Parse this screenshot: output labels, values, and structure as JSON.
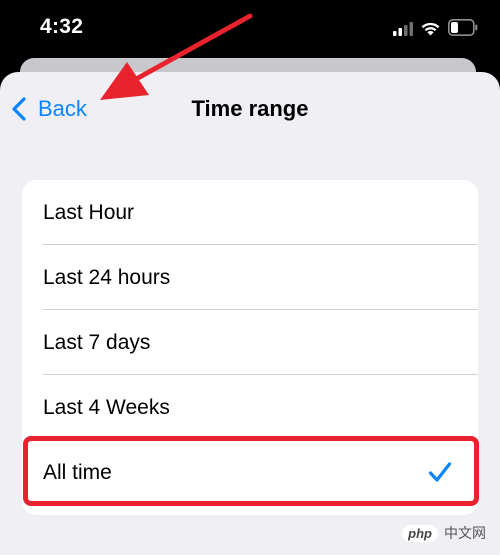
{
  "status_bar": {
    "time": "4:32",
    "icons": [
      "signal-icon",
      "wifi-icon",
      "battery-icon"
    ]
  },
  "nav": {
    "back_label": "Back",
    "title": "Time range"
  },
  "options": [
    {
      "label": "Last Hour",
      "selected": false
    },
    {
      "label": "Last 24 hours",
      "selected": false
    },
    {
      "label": "Last 7 days",
      "selected": false
    },
    {
      "label": "Last 4 Weeks",
      "selected": false
    },
    {
      "label": "All time",
      "selected": true
    }
  ],
  "watermark": {
    "badge": "php",
    "text": "中文网"
  },
  "colors": {
    "accent": "#0a84ff",
    "annotation": "#e8232d",
    "background": "#efeff4"
  }
}
